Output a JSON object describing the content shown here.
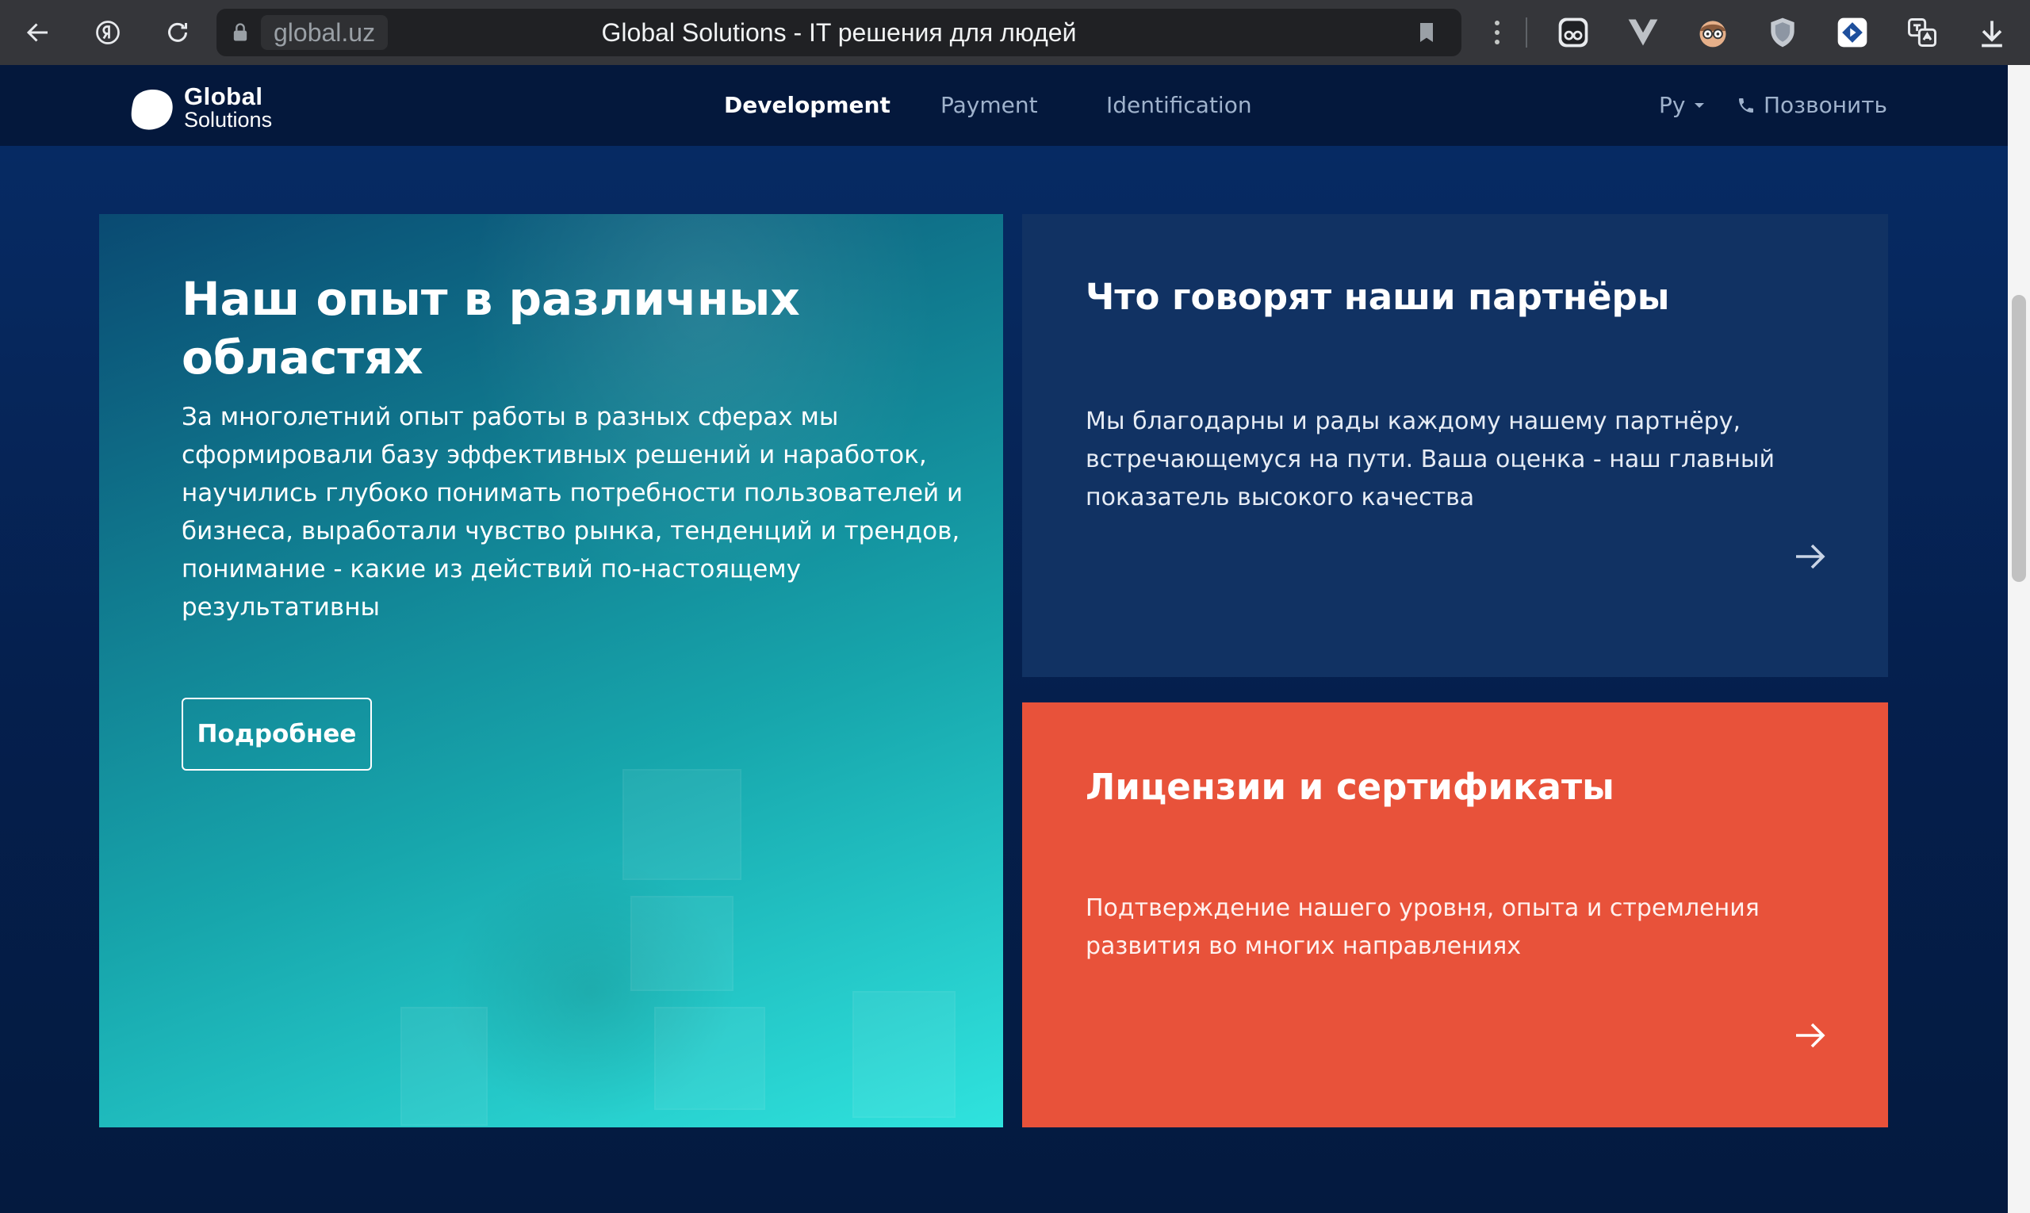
{
  "browser": {
    "domain": "global.uz",
    "tab_title": "Global Solutions - IT решения для людей",
    "icons": [
      "back-icon",
      "yandex-icon",
      "reload-icon",
      "lock-icon",
      "bookmark-icon",
      "more-icon",
      "extension-icons",
      "download-icon"
    ]
  },
  "header": {
    "logo_line1": "Global",
    "logo_line2": "Solutions",
    "nav": [
      {
        "label": "Development",
        "active": true
      },
      {
        "label": "Payment",
        "active": false
      },
      {
        "label": "Identification",
        "active": false
      }
    ],
    "lang": "Ру",
    "call_label": "Позвонить"
  },
  "experience": {
    "title": "Наш опыт в различных областях",
    "text": "За многолетний опыт работы в разных сферах мы сформировали базу эффективных решений и наработок, научились глубоко понимать потребности пользователей и бизнеса, выработали чувство рынка, тенденций и трендов, понимание - какие из действий по-настоящему результативны",
    "button_label": "Подробнее"
  },
  "partners": {
    "title": "Что говорят наши партнёры",
    "text": "Мы благодарны и рады каждому нашему партнёру, встречающемуся на пути. Ваша оценка - наш главный показатель высокого качества"
  },
  "licenses": {
    "title": "Лицензии и сертификаты",
    "text": "Подтверждение нашего уровня, опыта и стремления развития во многих направлениях"
  },
  "colors": {
    "header_bg": "#04183c",
    "partners_bg": "#113263",
    "licenses_bg": "#e8523a",
    "experience_gradient_end": "#2fe3de"
  }
}
